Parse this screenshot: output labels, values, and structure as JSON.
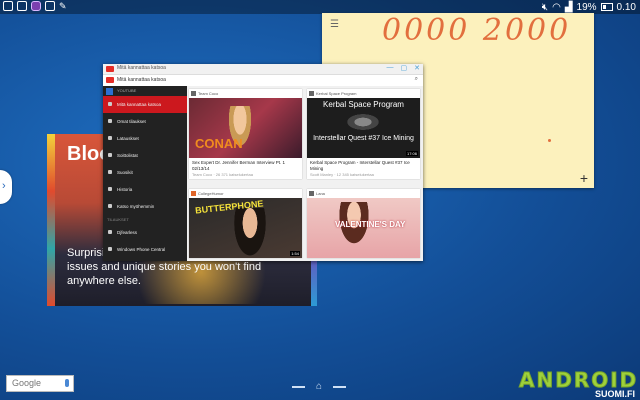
{
  "status_bar": {
    "battery": "19%",
    "time": "0.10"
  },
  "sticky_note": {
    "text": "0000 2000",
    "add_symbol": "+"
  },
  "flipboard": {
    "title": "Bloo Busi",
    "body": "Surprising ... on today's most important issues and unique stories you won't find anywhere else."
  },
  "youtube": {
    "window_title": "Mitä kannattaa katsoa",
    "subtitle": "Mitä kannattaa katsoa",
    "sidebar": {
      "header": "YOUTUBE",
      "items": [
        {
          "label": "Mitä kannattaa katsoa",
          "active": true
        },
        {
          "label": "Omat tilaukset"
        },
        {
          "label": "Latauskset"
        },
        {
          "label": "Soittolistat"
        },
        {
          "label": "Suosikit"
        },
        {
          "label": "Historia"
        },
        {
          "label": "Katso myöhemmin"
        }
      ],
      "section": "TILAUKSET",
      "subs": [
        {
          "label": "Djfearless"
        },
        {
          "label": "Windows Phone Central"
        }
      ]
    },
    "videos": [
      {
        "channel": "Team Coco",
        "title": "Sex Expert Dr. Jennifer Berman Interview Pt. 1 02/13/14",
        "meta": "Team Coco · 26 371 katselukertaa",
        "thumb_text": "CONAN",
        "duration": ""
      },
      {
        "channel": "Kerbal Space Program",
        "title": "Kerbal Space Program - Interstellar Quest #37 Ice Mining",
        "meta": "Scott Manley · 12 345 katselukertaa",
        "thumb_text_1": "Kerbal Space Program",
        "thumb_text_2": "Interstellar Quest #37 Ice Mining",
        "duration": "17:06"
      },
      {
        "channel": "CollegeHumor",
        "title": "",
        "meta": "",
        "thumb_text": "BUTTERPHONE",
        "duration": "1:54"
      },
      {
        "channel": "Lana",
        "title": "",
        "meta": "",
        "thumb_text": "VALENTINE'S DAY",
        "duration": ""
      }
    ]
  },
  "google_search": {
    "label": "Google"
  },
  "watermark": {
    "brand": "ANDROID",
    "sub": "SUOMI.FI"
  }
}
